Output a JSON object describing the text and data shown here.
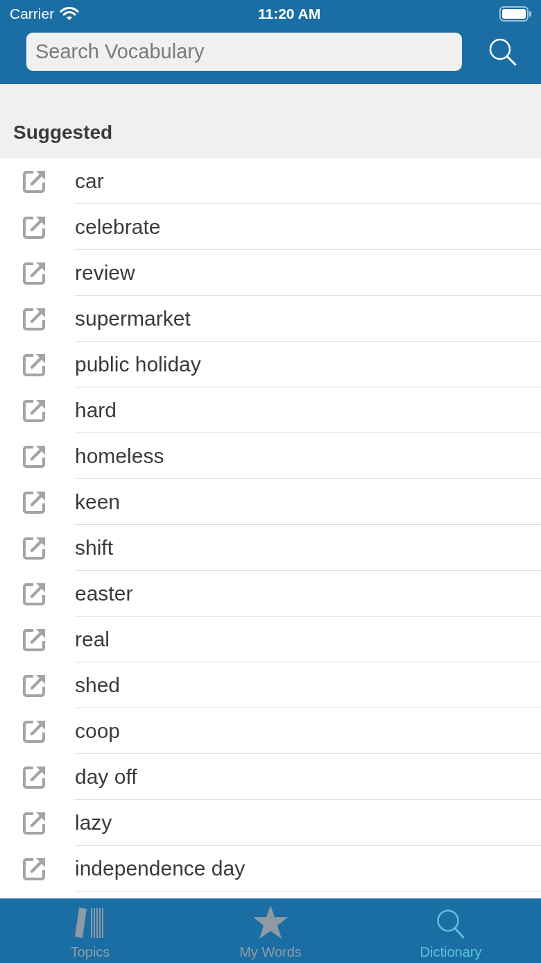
{
  "status_bar": {
    "carrier": "Carrier",
    "time": "11:20 AM"
  },
  "search": {
    "placeholder": "Search Vocabulary"
  },
  "section": {
    "title": "Suggested"
  },
  "words": [
    {
      "label": "car"
    },
    {
      "label": "celebrate"
    },
    {
      "label": "review"
    },
    {
      "label": "supermarket"
    },
    {
      "label": "public holiday"
    },
    {
      "label": "hard"
    },
    {
      "label": "homeless"
    },
    {
      "label": "keen"
    },
    {
      "label": "shift"
    },
    {
      "label": "easter"
    },
    {
      "label": "real"
    },
    {
      "label": "shed"
    },
    {
      "label": "coop"
    },
    {
      "label": "day off"
    },
    {
      "label": "lazy"
    },
    {
      "label": "independence day"
    }
  ],
  "tab_bar": [
    {
      "kind": "topics",
      "label": "Topics",
      "selected": false
    },
    {
      "kind": "words",
      "label": "My Words",
      "selected": false
    },
    {
      "kind": "dictionary",
      "label": "Dictionary",
      "selected": true
    }
  ]
}
